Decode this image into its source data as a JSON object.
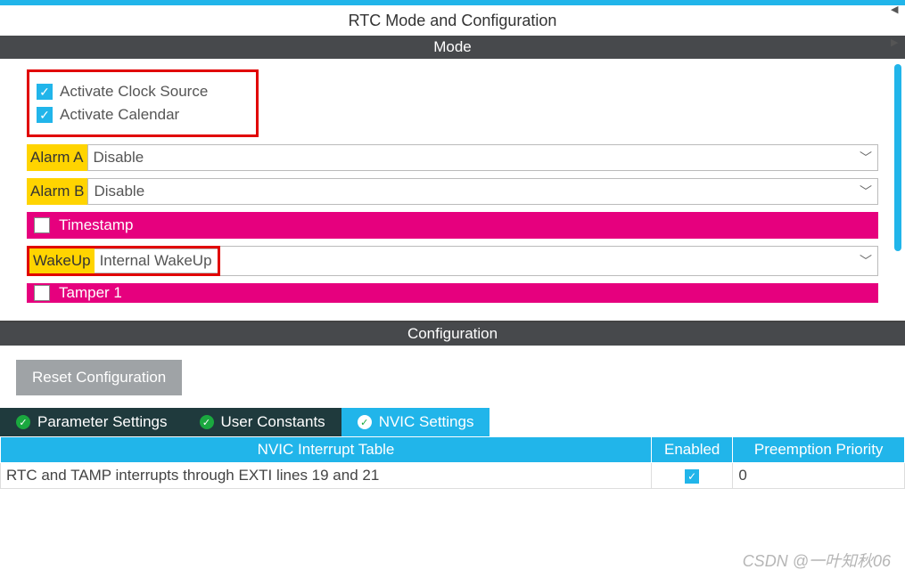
{
  "header": {
    "title": "RTC Mode and Configuration"
  },
  "sections": {
    "mode": "Mode",
    "config": "Configuration"
  },
  "mode": {
    "activate_clock": {
      "label": "Activate Clock Source",
      "checked": true
    },
    "activate_calendar": {
      "label": "Activate Calendar",
      "checked": true
    },
    "alarm_a": {
      "label": "Alarm A",
      "value": "Disable"
    },
    "alarm_b": {
      "label": "Alarm B",
      "value": "Disable"
    },
    "timestamp": {
      "label": "Timestamp",
      "checked": false
    },
    "wakeup": {
      "label": "WakeUp",
      "value": "Internal WakeUp"
    },
    "tamper1": {
      "label": "Tamper 1",
      "checked": false
    }
  },
  "config": {
    "reset_label": "Reset Configuration",
    "tabs": {
      "param": "Parameter Settings",
      "user": "User Constants",
      "nvic": "NVIC Settings"
    },
    "table": {
      "headers": {
        "name": "NVIC Interrupt Table",
        "enabled": "Enabled",
        "priority": "Preemption Priority"
      },
      "rows": [
        {
          "name": "RTC and TAMP interrupts through EXTI lines 19 and 21",
          "enabled": true,
          "priority": "0"
        }
      ]
    }
  },
  "watermark": "CSDN @一叶知秋06"
}
